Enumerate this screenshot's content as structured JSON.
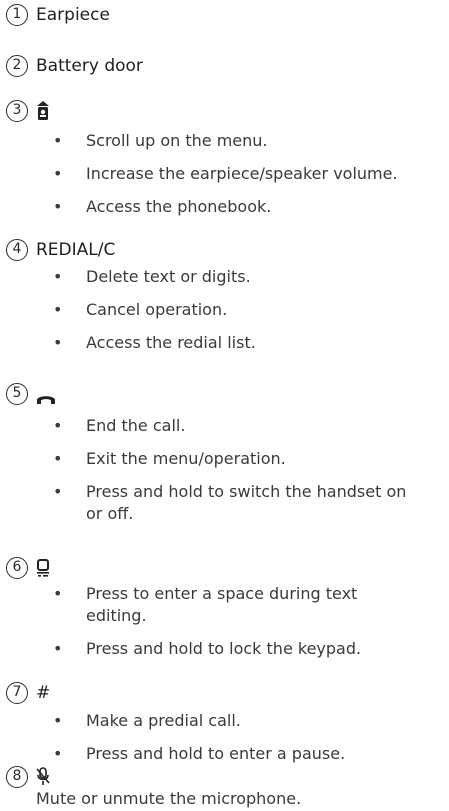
{
  "items": [
    {
      "num": "1",
      "label": "Earpiece"
    },
    {
      "num": "2",
      "label": "Battery door"
    },
    {
      "num": "3",
      "icon": "phonebook-up-icon",
      "bullets": [
        "Scroll up on the menu.",
        "Increase the earpiece/speaker volume.",
        "Access the phonebook."
      ]
    },
    {
      "num": "4",
      "label": "REDIAL/C",
      "bullets": [
        "Delete text or digits.",
        "Cancel operation.",
        "Access the redial list."
      ]
    },
    {
      "num": "5",
      "icon": "end-call-icon",
      "bullets": [
        "End the call.",
        "Exit the menu/operation.",
        "Press and hold to switch the handset on or off."
      ]
    },
    {
      "num": "6",
      "icon": "keylock-icon",
      "bullets": [
        "Press to enter a space during text editing.",
        "Press and hold to lock the keypad."
      ]
    },
    {
      "num": "7",
      "label": "#",
      "bullets": [
        "Make a predial call.",
        "Press and hold to enter a pause."
      ]
    },
    {
      "num": "8",
      "icon": "mute-microphone-icon",
      "text": "Mute or unmute the microphone."
    }
  ],
  "bullet_char": "•"
}
